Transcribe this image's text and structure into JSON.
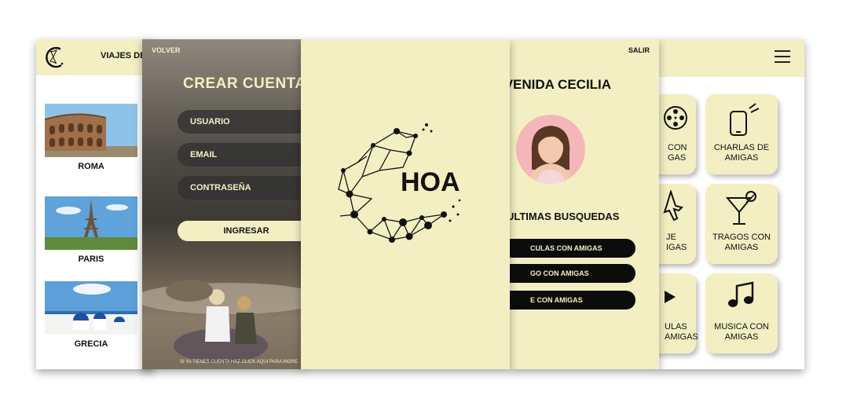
{
  "viajes": {
    "title": "VIAJES DE",
    "destinations": [
      "ROMA",
      "PARIS",
      "GRECIA"
    ]
  },
  "crear_cuenta": {
    "volver": "VOLVER",
    "title": "CREAR CUENTA",
    "fields": [
      "USUARIO",
      "EMAIL",
      "CONTRASEÑA"
    ],
    "submit": "INGRESAR",
    "footer": "SI YA TIENES CUENTA HAZ CLICK AQUI PARA INGRE"
  },
  "splash": {
    "brand": "HOA"
  },
  "bienvenida": {
    "salir": "SALIR",
    "welcome": "IVENIDA CECILIA",
    "ultimas": "ULTIMAS BUSQUEDAS",
    "searches": [
      "CULAS CON AMIGAS",
      "GO CON AMIGAS",
      "E CON AMIGAS"
    ]
  },
  "categorias": {
    "cards": [
      {
        "line1": "CON",
        "line2": "GAS",
        "icon": "film-reel-icon"
      },
      {
        "line1": "CHARLAS DE",
        "line2": "AMIGAS",
        "icon": "phone-icon"
      },
      {
        "line1": "JE",
        "line2": "IGAS",
        "icon": "airplane-icon"
      },
      {
        "line1": "TRAGOS CON",
        "line2": "AMIGAS",
        "icon": "cocktail-icon"
      },
      {
        "line1": "ULAS",
        "line2": "AMIGAS",
        "icon": "play-icon"
      },
      {
        "line1": "MUSICA CON",
        "line2": "AMIGAS",
        "icon": "music-note-icon"
      }
    ]
  },
  "colors": {
    "cream": "#f3efc3",
    "dark": "#111111",
    "pill": "#0c0c0c",
    "avatar_bg": "#f4b6b8"
  }
}
